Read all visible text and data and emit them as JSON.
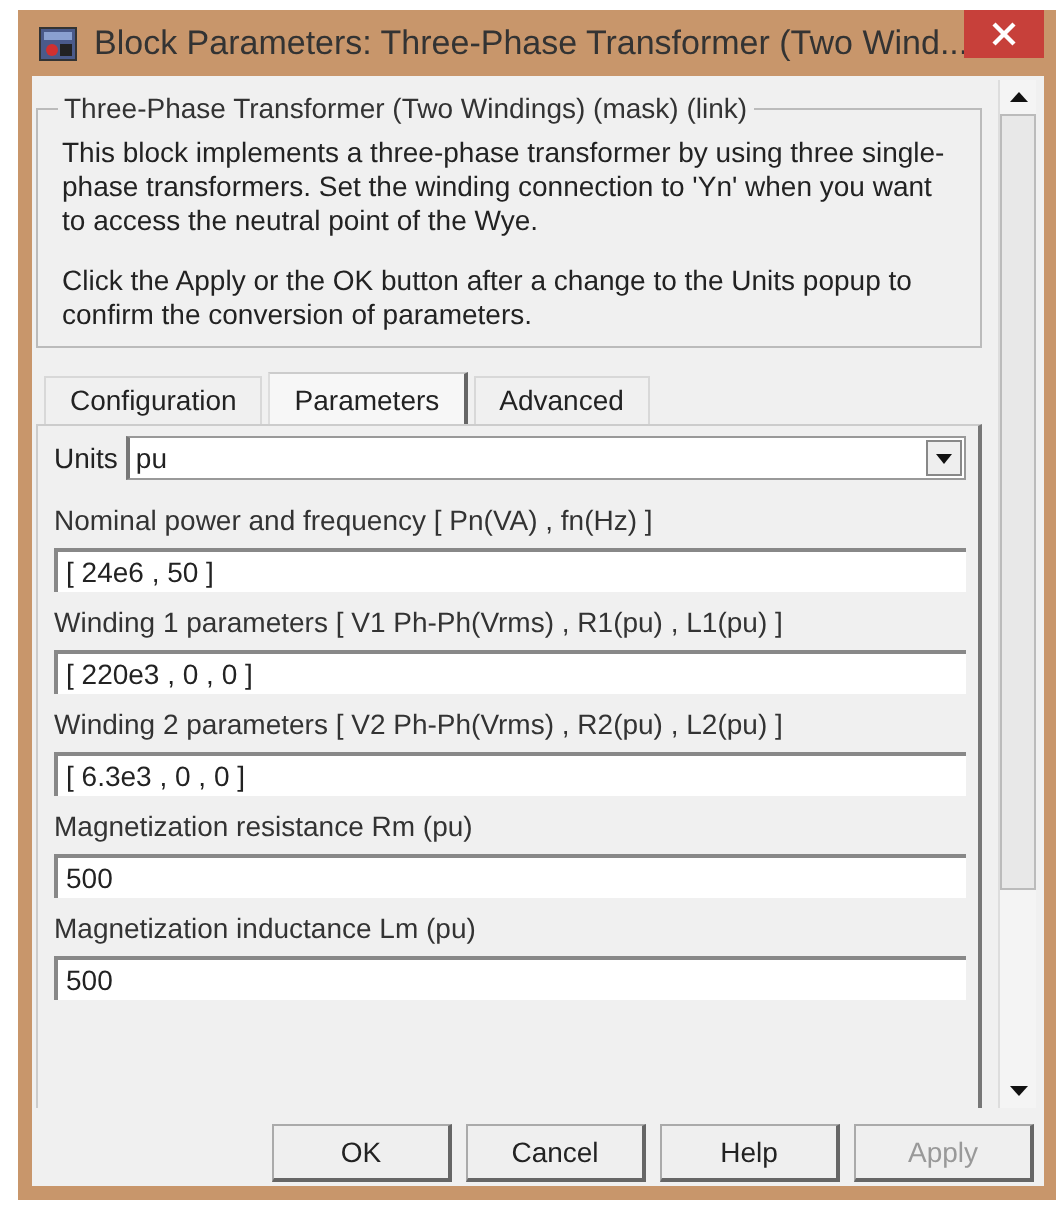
{
  "window": {
    "title": "Block Parameters: Three-Phase Transformer (Two Wind..."
  },
  "group": {
    "title": "Three-Phase Transformer (Two Windings) (mask) (link)",
    "paragraphs": [
      "This block implements a three-phase transformer by using three single-phase transformers. Set the winding connection to 'Yn' when you want to access the neutral point of the Wye.",
      "Click the Apply or the OK button after a change to the Units popup to confirm the conversion of parameters."
    ]
  },
  "tabs": [
    {
      "label": "Configuration",
      "selected": false
    },
    {
      "label": "Parameters",
      "selected": true
    },
    {
      "label": "Advanced",
      "selected": false
    }
  ],
  "units": {
    "label": "Units",
    "value": "pu"
  },
  "fields": [
    {
      "label": "Nominal power and frequency  [ Pn(VA) , fn(Hz) ]",
      "value": "[ 24e6 , 50 ]"
    },
    {
      "label": "Winding 1 parameters [ V1 Ph-Ph(Vrms) , R1(pu) , L1(pu) ]",
      "value": "[ 220e3 , 0 , 0 ]"
    },
    {
      "label": "Winding 2 parameters [ V2 Ph-Ph(Vrms) , R2(pu) , L2(pu) ]",
      "value": "[ 6.3e3 , 0 , 0 ]"
    },
    {
      "label": "Magnetization resistance  Rm (pu)",
      "value": "500"
    },
    {
      "label": "Magnetization inductance  Lm (pu)",
      "value": "500"
    }
  ],
  "buttons": [
    {
      "label": "OK",
      "disabled": false
    },
    {
      "label": "Cancel",
      "disabled": false
    },
    {
      "label": "Help",
      "disabled": false
    },
    {
      "label": "Apply",
      "disabled": true
    }
  ]
}
